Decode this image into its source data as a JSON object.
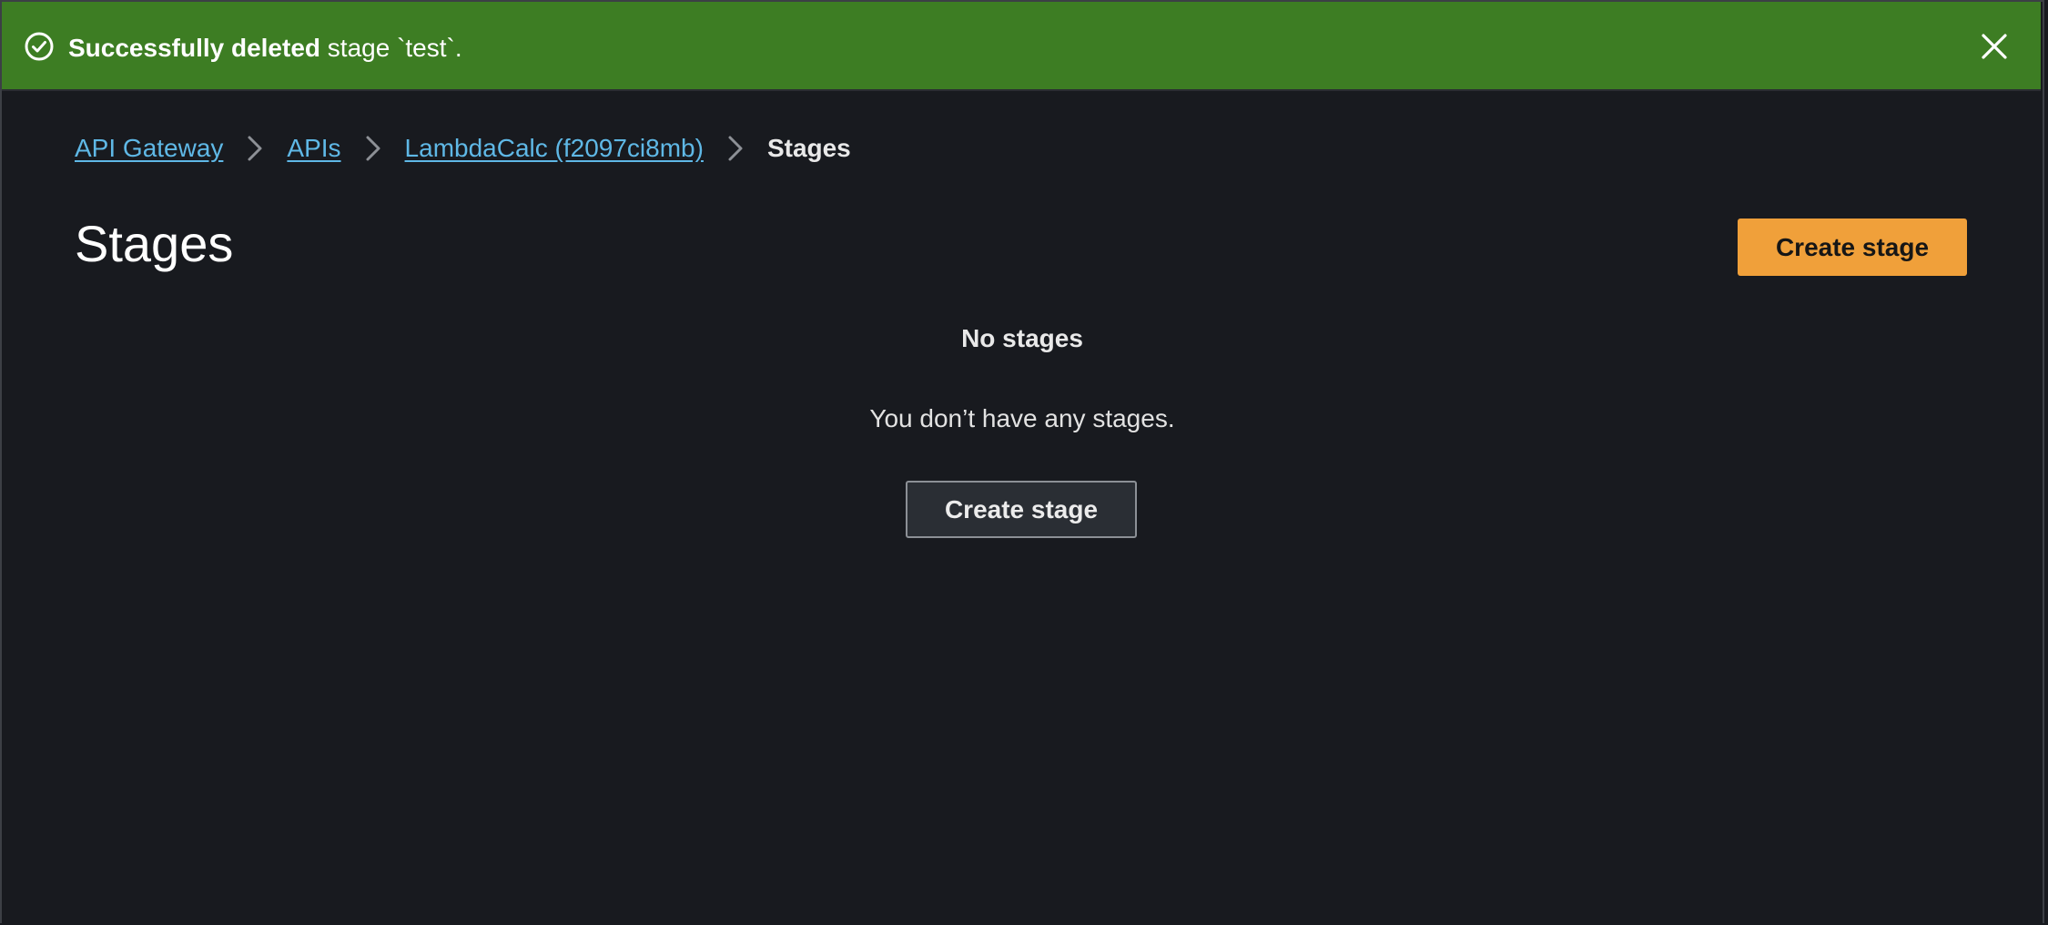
{
  "flash": {
    "bold_text": "Successfully deleted",
    "text": " stage `test`.",
    "icon": "check-circle-icon",
    "close_icon": "close-icon",
    "color": "#3d7d23"
  },
  "breadcrumb": {
    "items": [
      {
        "label": "API Gateway"
      },
      {
        "label": "APIs"
      },
      {
        "label": "LambdaCalc (f2097ci8mb)"
      }
    ],
    "current": "Stages",
    "separator_icon": "chevron-right-icon"
  },
  "page": {
    "title": "Stages",
    "primary_button": "Create stage",
    "primary_color": "#f0a03a"
  },
  "empty_state": {
    "title": "No stages",
    "description": "You don’t have any stages.",
    "button": "Create stage"
  },
  "colors": {
    "background": "#181a1f",
    "link": "#5fb8e6"
  }
}
